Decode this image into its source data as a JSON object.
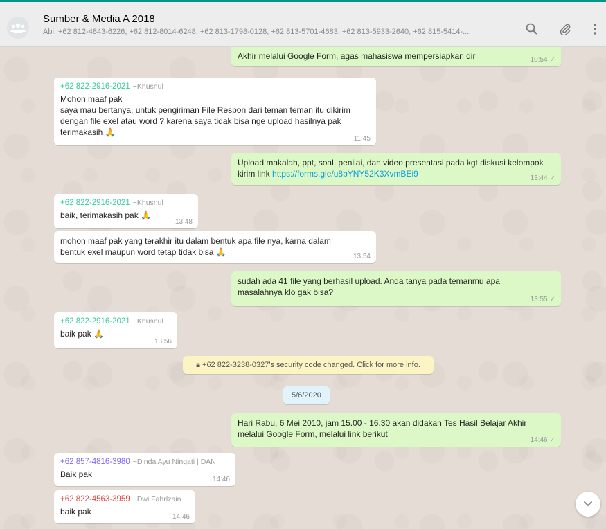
{
  "header": {
    "title": "Sumber & Media A 2018",
    "participants": "Abi, +62 812-4843-6226, +62 812-8014-6248, +62 813-1798-0128, +62 813-5701-4683, +62 813-5933-2640, +62 815-5414-..."
  },
  "icons": {
    "group_avatar": "group-icon",
    "search": "search-icon",
    "attach": "paperclip-icon",
    "menu": "menu-icon",
    "scroll_down": "chevron-down-icon"
  },
  "colors": {
    "accent": "#009688",
    "outgoing_bubble": "#dcf8c6",
    "incoming_bubble": "#ffffff"
  },
  "messages": [
    {
      "direction": "out",
      "text": "Akhir melalui Google Form, agas mahasiswa mempersiapkan dir",
      "time": "10:54"
    },
    {
      "direction": "in",
      "sender_number": "+62 822-2916-2021",
      "sender_name": "~Khusnul",
      "text": "Mohon maaf pak\nsaya mau bertanya, untuk pengiriman File Respon dari teman teman itu dikirim dengan file exel atau word ? karena saya tidak bisa nge upload hasilnya pak terimakasih",
      "emoji": "🙏",
      "time": "11:45"
    },
    {
      "direction": "out",
      "text": "Upload makalah, ppt, soal, penilai, dan video presentasi pada kgt diskusi kelompok kirim link",
      "link": "https://forms.gle/u8bYNY52K3XvmBEi9",
      "time": "13:44"
    },
    {
      "direction": "in",
      "sender_number": "+62 822-2916-2021",
      "sender_name": "~Khusnul",
      "text": "baik, terimakasih pak",
      "emoji": "🙏",
      "time": "13:48"
    },
    {
      "direction": "in",
      "text": "mohon maaf pak yang terakhir itu dalam bentuk apa file nya, karna dalam bentuk exel maupun word tetap tidak bisa",
      "emoji": "🙏",
      "time": "13:54"
    },
    {
      "direction": "out",
      "text": "sudah ada 41 file yang berhasil upload. Anda tanya pada temanmu apa masalahnya klo gak bisa?",
      "time": "13:55"
    },
    {
      "direction": "in",
      "sender_number": "+62 822-2916-2021",
      "sender_name": "~Khusnul",
      "text": "baik pak",
      "emoji": "🙏",
      "time": "13:56"
    },
    {
      "direction": "out",
      "text": "Hari Rabu, 6 Mei 2010, jam 15.00 - 16.30 akan didakan Tes Hasil Belajar Akhir melalui Google Form, melalui link berikut",
      "time": "14:46"
    },
    {
      "direction": "in",
      "sender_number": "+62 857-4816-3980",
      "sender_name": "~Dinda Ayu Ningati | DAN",
      "text": "Baik pak",
      "time": "14:46"
    },
    {
      "direction": "in",
      "sender_number": "+62 822-4563-3959",
      "sender_name": "~Dwi Fahrlzain",
      "text": "baik pak",
      "time": "14:46"
    }
  ],
  "system": {
    "security_notice": "+62 822-3238-0327's security code changed. Click for more info.",
    "date": "5/6/2020"
  }
}
